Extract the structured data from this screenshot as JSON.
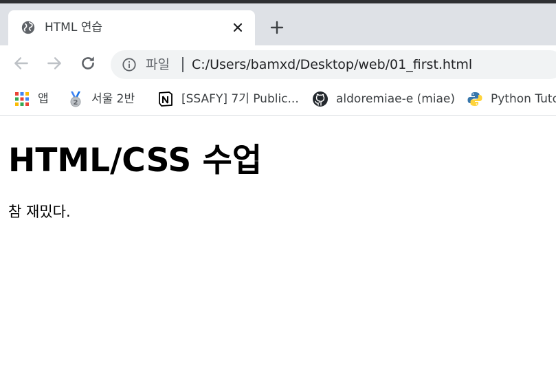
{
  "browser": {
    "tab": {
      "title": "HTML 연습",
      "favicon": "globe-icon"
    },
    "omnibox": {
      "scheme_label": "파일",
      "url": "C:/Users/bamxd/Desktop/web/01_first.html"
    },
    "bookmarks": [
      {
        "label": "앱",
        "icon": "apps-grid-icon"
      },
      {
        "label": "서울 2반",
        "icon": "medal-icon"
      },
      {
        "label": "[SSAFY] 7기 Public...",
        "icon": "notion-icon"
      },
      {
        "label": "aldoremiae-e (miae)",
        "icon": "github-icon"
      },
      {
        "label": "Python Tuto",
        "icon": "python-icon"
      }
    ]
  },
  "page": {
    "heading": "HTML/CSS 수업",
    "paragraph": "참 재밌다."
  },
  "colors": {
    "titlebar": "#dee1e6",
    "omnibox": "#f1f3f4",
    "icon_gray": "#5f6368",
    "text_dark": "#202124"
  }
}
